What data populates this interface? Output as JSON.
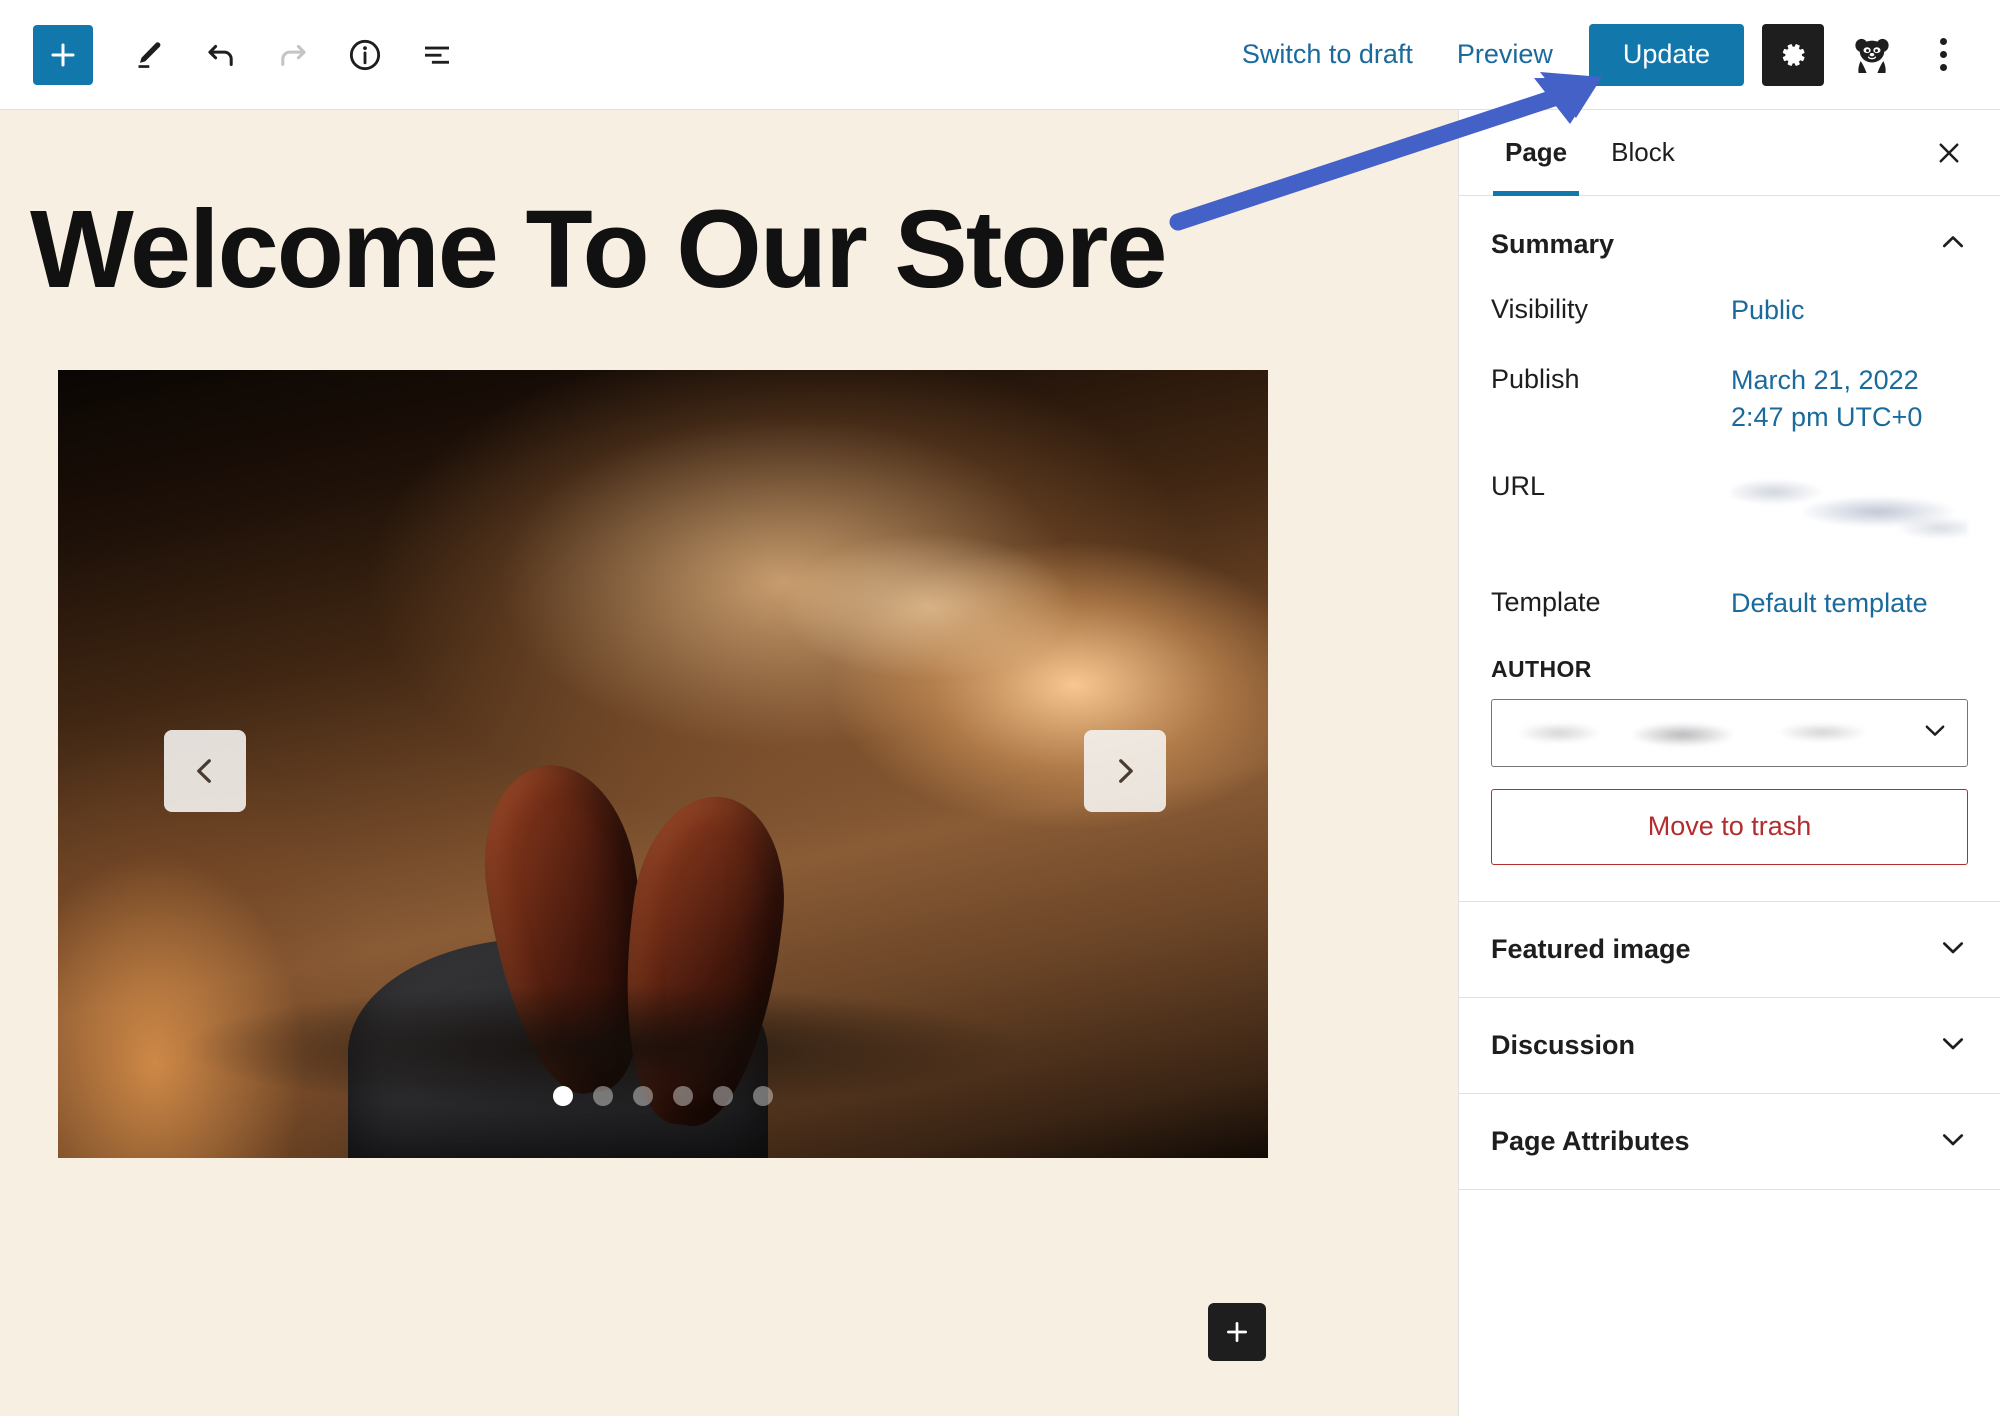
{
  "toolbar": {
    "add_block_label": "+",
    "icons": [
      "add-block-icon",
      "edit-tool-icon",
      "undo-icon",
      "redo-icon",
      "info-icon",
      "list-view-icon"
    ],
    "switch_to_draft_label": "Switch to draft",
    "preview_label": "Preview",
    "update_label": "Update",
    "settings_icon": "gear-icon",
    "avatar_icon": "panda-avatar-icon",
    "more_icon": "vertical-ellipsis-icon",
    "accent_color": "#1278ac",
    "link_color": "#1b6a9c"
  },
  "canvas": {
    "page_title": "Welcome To Our Store",
    "background_color": "#f7efe1",
    "carousel": {
      "prev_label": "‹",
      "next_label": "›",
      "dot_count": 6,
      "active_dot": 1
    },
    "inserter_label": "+"
  },
  "sidebar": {
    "tabs": [
      {
        "label": "Page",
        "active": true
      },
      {
        "label": "Block",
        "active": false
      }
    ],
    "close_label": "×",
    "summary": {
      "title": "Summary",
      "rows": [
        {
          "label": "Visibility",
          "value": "Public",
          "redacted": false
        },
        {
          "label": "Publish",
          "value": "March 21, 2022\n2:47 pm UTC+0",
          "redacted": false
        },
        {
          "label": "URL",
          "value": "",
          "redacted": true
        },
        {
          "label": "Template",
          "value": "Default template",
          "redacted": false
        }
      ],
      "author_label": "AUTHOR",
      "author_value": "",
      "trash_label": "Move to trash",
      "trash_color": "#b32d2e"
    },
    "sections": [
      {
        "label": "Featured image"
      },
      {
        "label": "Discussion"
      },
      {
        "label": "Page Attributes"
      }
    ]
  },
  "annotation": {
    "type": "arrow",
    "color": "#4461c8",
    "points_at": "Update"
  }
}
